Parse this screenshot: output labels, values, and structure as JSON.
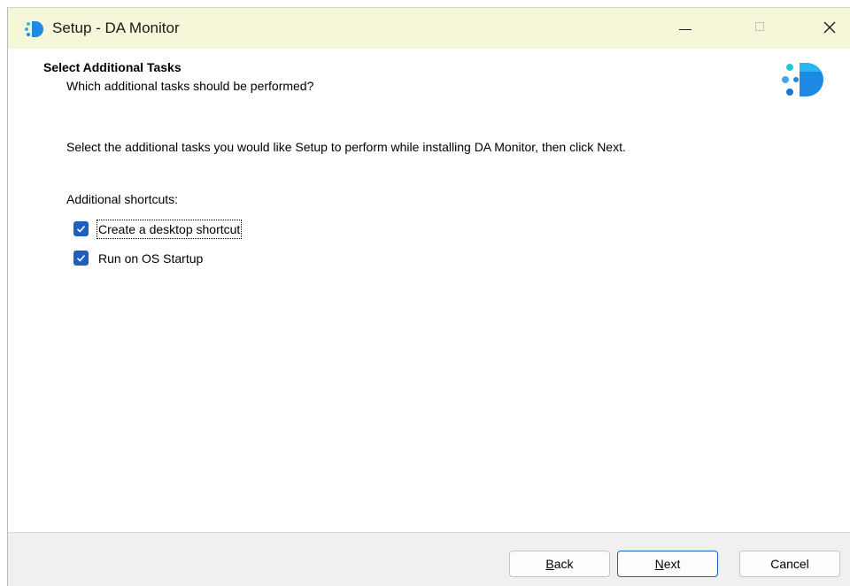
{
  "window": {
    "title": "Setup - DA Monitor",
    "controls": {
      "minimize": "minimize-icon",
      "maximize": "maximize-icon",
      "close": "close-icon"
    }
  },
  "header": {
    "title": "Select Additional Tasks",
    "subtitle": "Which additional tasks should be performed?"
  },
  "main": {
    "instruction": "Select the additional tasks you would like Setup to perform while installing DA Monitor, then click Next.",
    "group_label": "Additional shortcuts:",
    "tasks": [
      {
        "label": "Create a desktop shortcut",
        "checked": true
      },
      {
        "label": "Run on OS Startup",
        "checked": true
      }
    ]
  },
  "footer": {
    "back": {
      "accel": "B",
      "rest": "ack"
    },
    "next": {
      "accel": "N",
      "rest": "ext"
    },
    "cancel": "Cancel"
  },
  "colors": {
    "titlebar": "#f6f7d8",
    "accent": "#1f5fbf",
    "footer": "#f0f0f0"
  }
}
